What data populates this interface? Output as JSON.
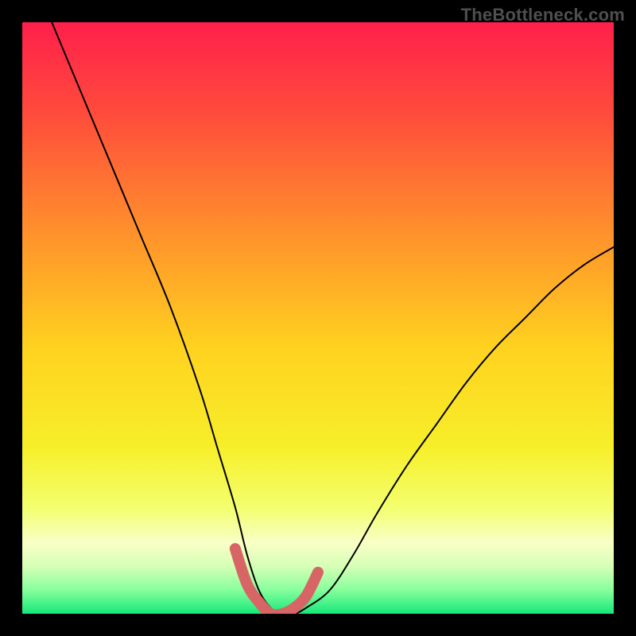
{
  "watermark": "TheBottleneck.com",
  "chart_data": {
    "type": "line",
    "title": "",
    "xlabel": "",
    "ylabel": "",
    "xlim": [
      0,
      100
    ],
    "ylim": [
      0,
      100
    ],
    "grid": false,
    "legend": false,
    "background_gradient_stops": [
      {
        "offset": 0,
        "color": "#ff1f4b"
      },
      {
        "offset": 0.15,
        "color": "#ff4a3c"
      },
      {
        "offset": 0.35,
        "color": "#ff8f2c"
      },
      {
        "offset": 0.55,
        "color": "#ffd21f"
      },
      {
        "offset": 0.72,
        "color": "#f7ef2a"
      },
      {
        "offset": 0.82,
        "color": "#f3ff6e"
      },
      {
        "offset": 0.88,
        "color": "#f9ffc6"
      },
      {
        "offset": 0.92,
        "color": "#d6ffb6"
      },
      {
        "offset": 0.96,
        "color": "#86ff9c"
      },
      {
        "offset": 1.0,
        "color": "#16e87a"
      }
    ],
    "series": [
      {
        "name": "bottleneck-curve",
        "x": [
          5,
          10,
          15,
          20,
          25,
          30,
          33,
          36,
          38,
          40,
          42,
          44,
          46,
          48,
          52,
          56,
          60,
          65,
          70,
          75,
          80,
          85,
          90,
          95,
          100
        ],
        "values": [
          100,
          88,
          76,
          64,
          52,
          38,
          28,
          18,
          10,
          4,
          1,
          0,
          0,
          1,
          4,
          10,
          17,
          25,
          32,
          39,
          45,
          50,
          55,
          59,
          62
        ]
      }
    ],
    "highlight": {
      "name": "optimal-range",
      "color": "#d86565",
      "stroke_width": 14,
      "x": [
        36,
        38,
        40,
        42,
        44,
        46,
        48,
        50
      ],
      "values": [
        11,
        5,
        2,
        0,
        0,
        1,
        3,
        7
      ]
    }
  }
}
